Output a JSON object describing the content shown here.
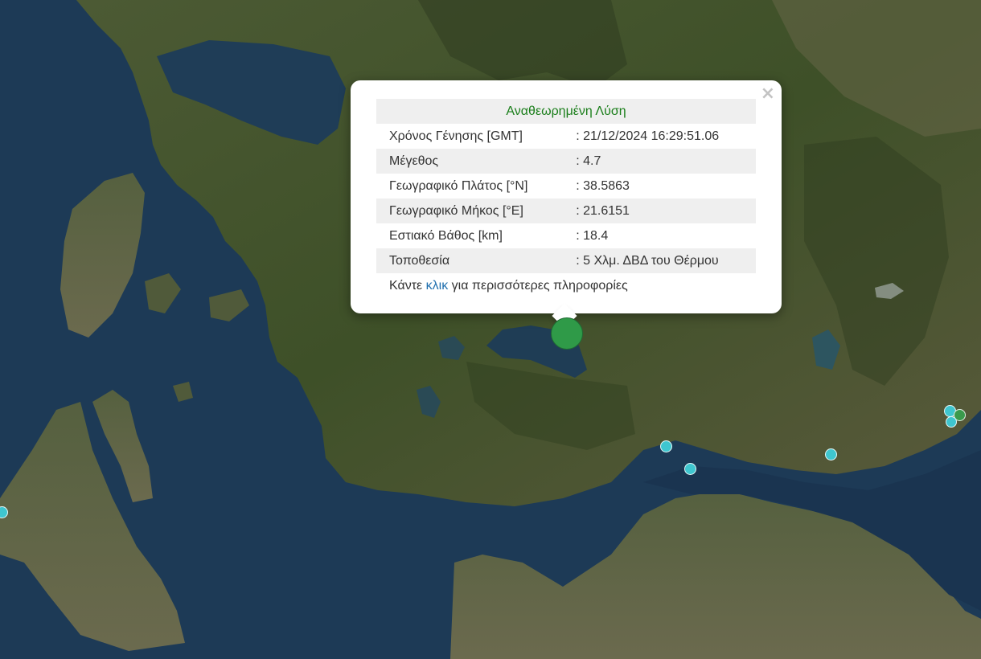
{
  "popup": {
    "title": "Αναθεωρημένη Λύση",
    "close_glyph": "×",
    "rows": [
      {
        "label": "Χρόνος Γένησης [GMT]",
        "value": ": 21/12/2024 16:29:51.06"
      },
      {
        "label": "Μέγεθος",
        "value": ": 4.7"
      },
      {
        "label": "Γεωγραφικό Πλάτος [°N]",
        "value": ": 38.5863"
      },
      {
        "label": "Γεωγραφικό Μήκος [°E]",
        "value": ": 21.6151"
      },
      {
        "label": "Εστιακό Βάθος [km]",
        "value": ": 18.4"
      },
      {
        "label": "Τοποθεσία",
        "value": ": 5 Χλμ. ΔΒΔ του Θέρμου"
      }
    ],
    "more_prefix": "Κάντε",
    "more_link": "κλικ",
    "more_suffix": "για περισσότερες πληροφορίες"
  },
  "colors": {
    "title": "#1a7e1a",
    "link": "#1f6fae",
    "recent_marker": "#3fc6cf",
    "selected_marker": "#2f9a48"
  }
}
